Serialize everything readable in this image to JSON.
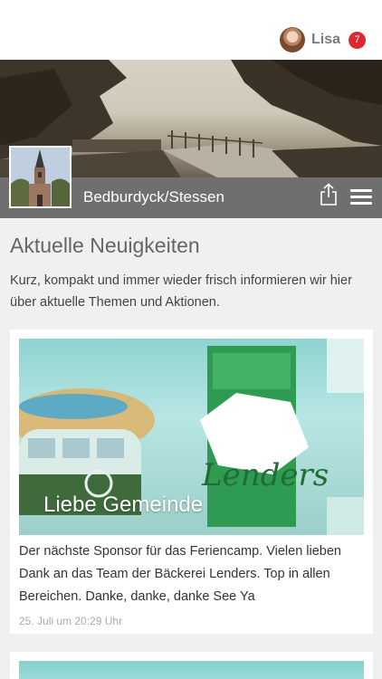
{
  "header": {
    "user_name": "Lisa",
    "notification_count": "7",
    "avatar_icon": "user-avatar"
  },
  "location": {
    "name": "Bedburdyck/Stessen",
    "share_icon": "share-icon",
    "menu_icon": "hamburger-menu-icon"
  },
  "news": {
    "title": "Aktuelle Neuigkeiten",
    "intro": "Kurz, kompakt und immer wieder frisch informieren wir hier über aktuelle Themen und Aktionen.",
    "items": [
      {
        "title": "Liebe Gemeinde",
        "text": "Der nächste Sponsor für das Feriencamp. Vielen lieben Dank an das Team der Bäckerei Lenders. Top in allen Bereichen. Danke, danke, danke See Ya",
        "date": "25. Juli um 20:29 Uhr"
      }
    ]
  },
  "colors": {
    "badge": "#e0262e",
    "location_bar": "#6f6f6f",
    "background": "#f0f0f0"
  }
}
